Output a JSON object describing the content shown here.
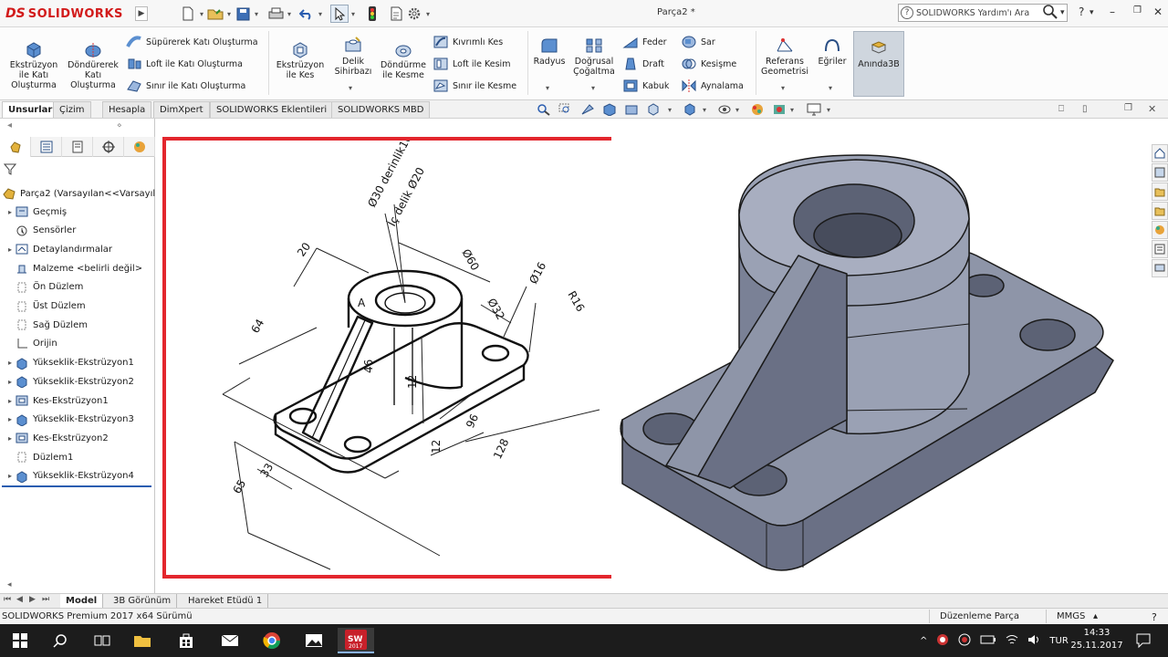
{
  "app": {
    "logo_ds": "DS",
    "logo_text": "SOLIDWORKS",
    "document_title": "Parça2 *",
    "help_search_text": "SOLIDWORKS Yardım'ı Ara"
  },
  "ribbon": {
    "extrude_boss": "Ekstrüzyon ile Katı Oluşturma",
    "revolve_boss": "Döndürerek Katı Oluşturma",
    "swept_boss": "Süpürerek Katı Oluşturma",
    "loft_boss": "Loft ile Katı Oluşturma",
    "boundary_boss": "Sınır ile Katı Oluşturma",
    "extrude_cut": "Ekstrüzyon ile Kes",
    "hole_wizard": "Delik Sihirbazı",
    "revolve_cut": "Döndürme ile Kesme",
    "swept_cut": "Kıvrımlı Kes",
    "loft_cut": "Loft ile Kesim",
    "boundary_cut": "Sınır ile Kesme",
    "fillet": "Radyus",
    "linear_pattern": "Doğrusal Çoğaltma",
    "rib": "Feder",
    "draft": "Draft",
    "shell": "Kabuk",
    "wrap": "Sar",
    "intersect": "Kesişme",
    "mirror": "Aynalama",
    "ref_geometry": "Referans Geometrisi",
    "curves": "Eğriler",
    "instant3d": "Anında3B"
  },
  "command_tabs": [
    "Unsurlar",
    "Çizim",
    "Hesapla",
    "DimXpert",
    "SOLIDWORKS Eklentileri",
    "SOLIDWORKS MBD"
  ],
  "feature_tree": {
    "root": "Parça2  (Varsayılan<<Varsayıl",
    "items": [
      {
        "label": "Geçmiş",
        "expandable": true
      },
      {
        "label": "Sensörler",
        "expandable": false
      },
      {
        "label": "Detaylandırmalar",
        "expandable": true
      },
      {
        "label": "Malzeme <belirli değil>",
        "expandable": false
      },
      {
        "label": "Ön Düzlem",
        "expandable": false
      },
      {
        "label": "Üst Düzlem",
        "expandable": false
      },
      {
        "label": "Sağ Düzlem",
        "expandable": false
      },
      {
        "label": "Orijin",
        "expandable": false
      },
      {
        "label": "Yükseklik-Ekstrüzyon1",
        "expandable": true
      },
      {
        "label": "Yükseklik-Ekstrüzyon2",
        "expandable": true
      },
      {
        "label": "Kes-Ekstrüzyon1",
        "expandable": true
      },
      {
        "label": "Yükseklik-Ekstrüzyon3",
        "expandable": true
      },
      {
        "label": "Kes-Ekstrüzyon2",
        "expandable": true
      },
      {
        "label": "Düzlem1",
        "expandable": false
      },
      {
        "label": "Yükseklik-Ekstrüzyon4",
        "expandable": true
      }
    ]
  },
  "drawing_dims": {
    "d1": "Ø30 derinlik10",
    "d2": "İç delik Ø20",
    "d3": "20",
    "d4": "Ø60",
    "d5": "Ø16",
    "d6": "R16",
    "d7": "Ø32",
    "d8": "64",
    "d9": "46",
    "d10": "12",
    "d11": "96",
    "d12": "12",
    "d13": "128",
    "d14": "33",
    "d15": "65",
    "d16": "A"
  },
  "bottom_tabs": [
    "Model",
    "3B Görünüm",
    "Hareket Etüdü 1"
  ],
  "status": {
    "left": "SOLIDWORKS Premium 2017 x64 Sürümü",
    "mode": "Düzenleme Parça",
    "units": "MMGS"
  },
  "taskbar": {
    "lang": "TUR",
    "time": "14:33",
    "date": "25.11.2017",
    "sw_badge": "2017"
  },
  "colors": {
    "accent_red": "#e3262d",
    "model_face": "#8e95a8",
    "model_dark": "#5c6275",
    "taskbar": "#1c1c1c"
  }
}
